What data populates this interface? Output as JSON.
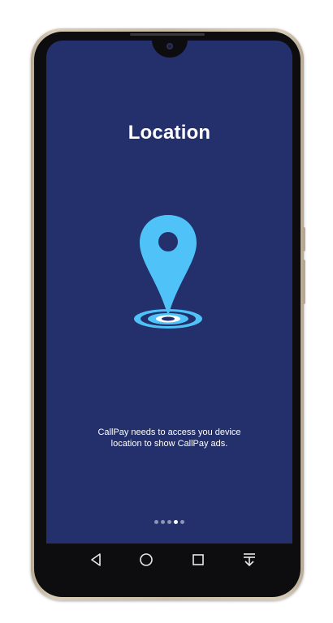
{
  "screen": {
    "title": "Location",
    "description_line1": "CallPay needs to access you device",
    "description_line2": "location to show CallPay ads."
  },
  "pagination": {
    "total": 5,
    "active_index": 3
  },
  "icons": {
    "illustration": "map-pin-on-target",
    "nav_back": "triangle-back-icon",
    "nav_home": "circle-home-icon",
    "nav_recents": "square-recents-icon",
    "nav_notifications": "pull-down-icon"
  },
  "colors": {
    "screen_background": "#23306b",
    "pin": "#4fc3f7",
    "text": "#ffffff",
    "dot_inactive": "#8d94b4",
    "dot_active": "#ffffff"
  }
}
